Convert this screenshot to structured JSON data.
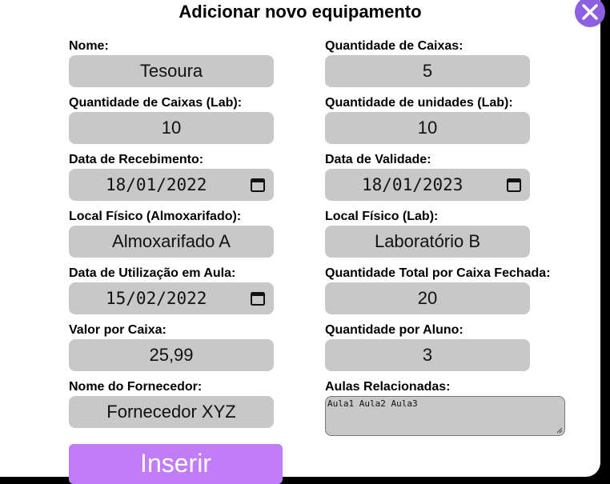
{
  "dialog": {
    "title": "Adicionar novo equipamento",
    "close_icon": "close-icon",
    "accent_color": "#8e5fe0"
  },
  "fields": {
    "nome": {
      "label": "Nome:",
      "value": "Tesoura"
    },
    "qtd_caixas": {
      "label": "Quantidade de Caixas:",
      "value": "5"
    },
    "qtd_caixas_lab": {
      "label": "Quantidade de Caixas (Lab):",
      "value": "10"
    },
    "qtd_unidades_lab": {
      "label": "Quantidade de unidades (Lab):",
      "value": "10"
    },
    "data_recebimento": {
      "label": "Data de Recebimento:",
      "value": "18/01/2022"
    },
    "data_validade": {
      "label": "Data de Validade:",
      "value": "18/01/2023"
    },
    "local_almox": {
      "label": "Local Físico (Almoxarifado):",
      "value": "Almoxarifado A"
    },
    "local_lab": {
      "label": "Local Físico (Lab):",
      "value": "Laboratório B"
    },
    "data_utilizacao": {
      "label": "Data de Utilização em Aula:",
      "value": "15/02/2022"
    },
    "qtd_total_caixa": {
      "label": "Quantidade Total por Caixa Fechada:",
      "value": "20"
    },
    "valor_caixa": {
      "label": "Valor por Caixa:",
      "value": "25,99"
    },
    "qtd_aluno": {
      "label": "Quantidade por Aluno:",
      "value": "3"
    },
    "fornecedor": {
      "label": "Nome do Fornecedor:",
      "value": "Fornecedor XYZ"
    },
    "aulas": {
      "label": "Aulas Relacionadas:",
      "value": "Aula1 Aula2 Aula3"
    }
  },
  "submit": {
    "label": "Inserir",
    "color": "#c17cf7"
  },
  "input_bg": "#c8c8c8"
}
